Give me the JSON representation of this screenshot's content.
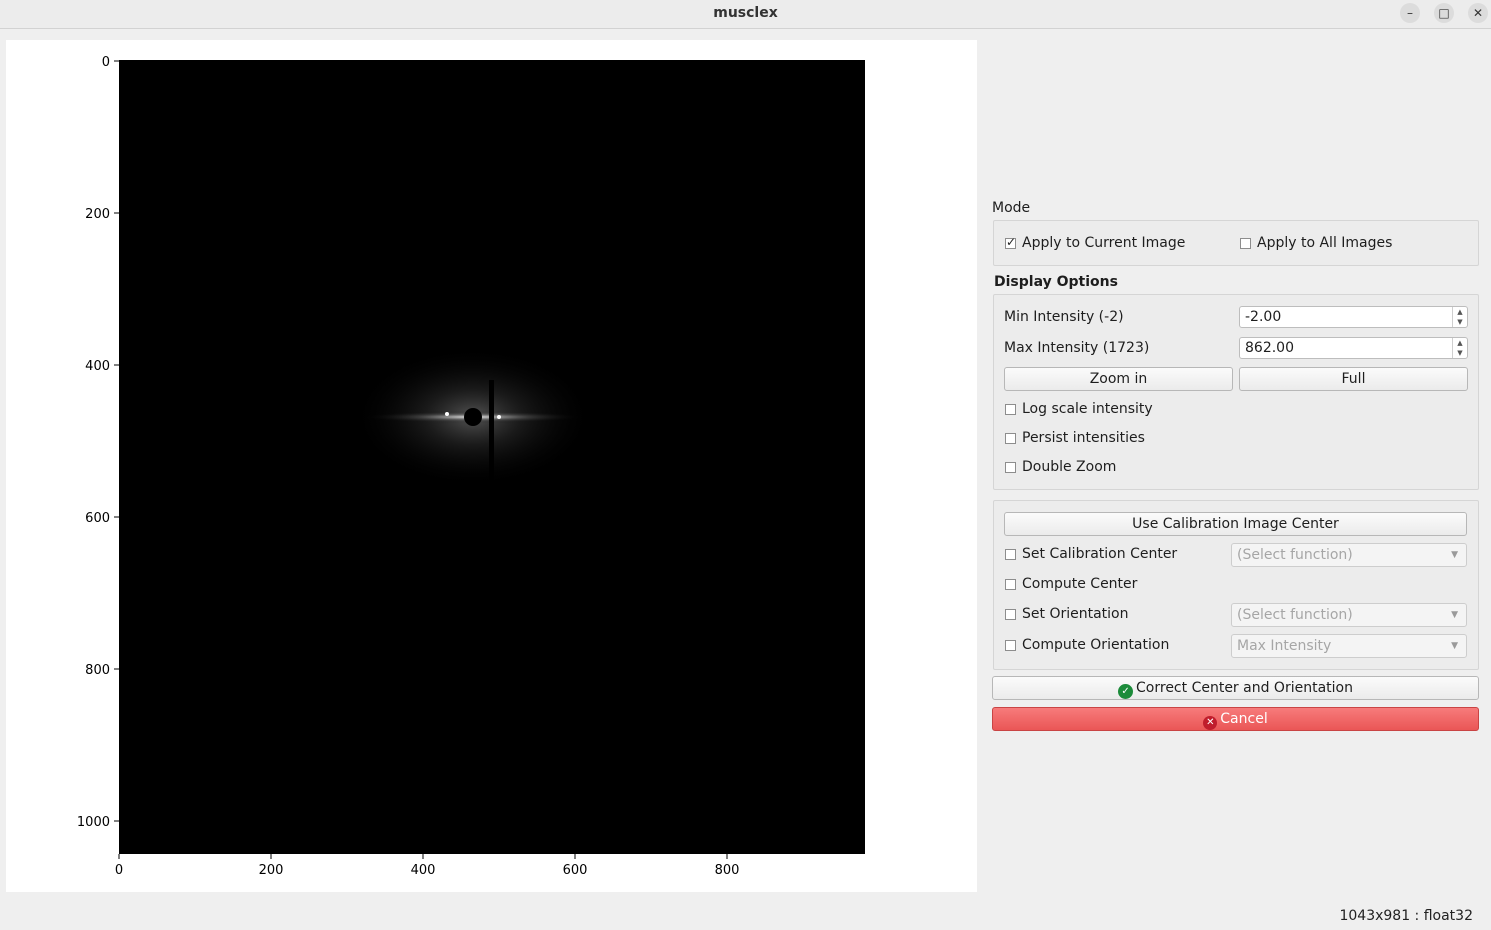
{
  "window": {
    "title": "musclex",
    "minimize_glyph": "–",
    "maximize_glyph": "□",
    "close_glyph": "✕"
  },
  "plot": {
    "x_ticks": [
      "0",
      "200",
      "400",
      "600",
      "800"
    ],
    "y_ticks": [
      "0",
      "200",
      "400",
      "600",
      "800",
      "1000"
    ],
    "image_icon": "diffraction-image"
  },
  "mode": {
    "label": "Mode",
    "apply_current": "Apply to Current Image",
    "apply_current_checked": true,
    "apply_all": "Apply to All Images",
    "apply_all_checked": false
  },
  "display": {
    "title": "Display Options",
    "min_label": "Min Intensity (-2)",
    "min_value": "-2.00",
    "max_label": "Max Intensity (1723)",
    "max_value": "862.00",
    "zoom_in": "Zoom in",
    "full": "Full",
    "log_scale": "Log scale intensity",
    "persist": "Persist intensities",
    "double_zoom": "Double Zoom"
  },
  "center": {
    "use_calibration": "Use Calibration Image Center",
    "set_calibration": "Set Calibration Center",
    "set_calibration_select": "(Select function)",
    "compute_center": "Compute Center",
    "set_orientation": "Set Orientation",
    "set_orientation_select": "(Select function)",
    "compute_orientation": "Compute Orientation",
    "compute_orientation_select": "Max Intensity"
  },
  "actions": {
    "correct": "Correct Center and Orientation",
    "cancel": "Cancel",
    "ok_icon": "check-circle-icon",
    "cancel_icon": "x-circle-icon"
  },
  "status": {
    "info": "1043x981 : float32"
  }
}
